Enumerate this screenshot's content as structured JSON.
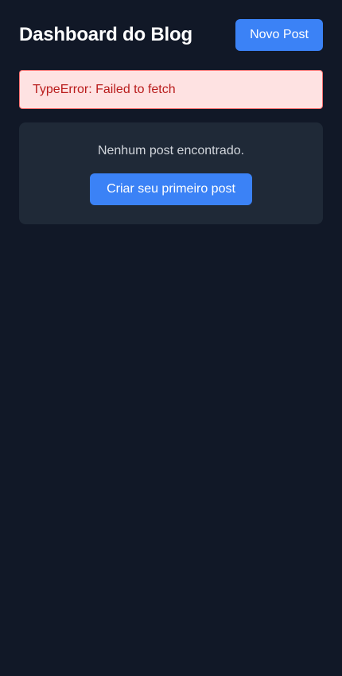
{
  "header": {
    "title": "Dashboard do Blog",
    "new_post_label": "Novo Post"
  },
  "error": {
    "message": "TypeError: Failed to fetch"
  },
  "empty_state": {
    "message": "Nenhum post encontrado.",
    "cta_label": "Criar seu primeiro post"
  },
  "colors": {
    "background": "#111827",
    "card": "#1f2937",
    "accent": "#3b82f6",
    "error_bg": "#fee2e2",
    "error_border": "#f87171",
    "error_text": "#b91c1c"
  }
}
